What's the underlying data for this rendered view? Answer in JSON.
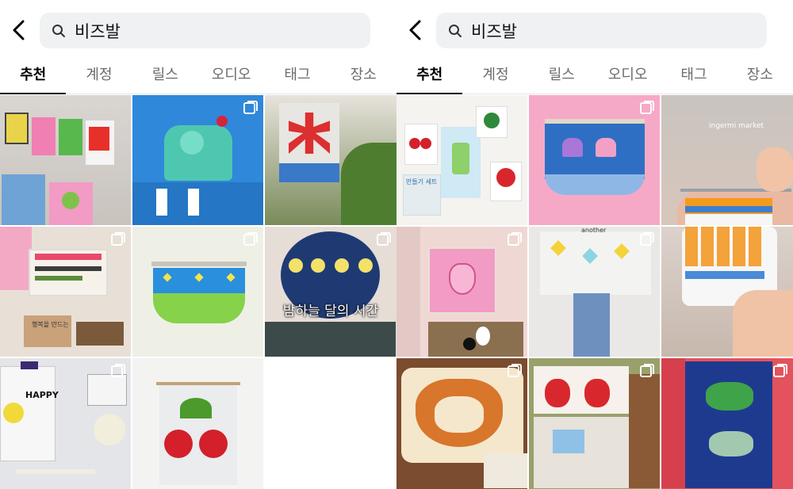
{
  "search": {
    "query": "비즈발"
  },
  "tabs": [
    "추천",
    "계정",
    "릴스",
    "오디오",
    "태그",
    "장소"
  ],
  "active_tab": "추천",
  "left_grid": {
    "tile_7_caption": "밤하늘 달의 시간",
    "tile_5_text": "행복을 만드는",
    "tile_8_text": "HAPPY"
  },
  "right_grid": {
    "tile_1_label": "만들기 세트",
    "tile_3_label": "ingermi market",
    "tile_5_text": "another"
  },
  "icons": {
    "back": "chevron-left-icon",
    "search": "magnifier-icon",
    "multi_post": "carousel-icon"
  },
  "colors": {
    "active_tab": "#000000",
    "inactive_tab": "#6b6b6b",
    "search_bg": "#eff1f3"
  }
}
